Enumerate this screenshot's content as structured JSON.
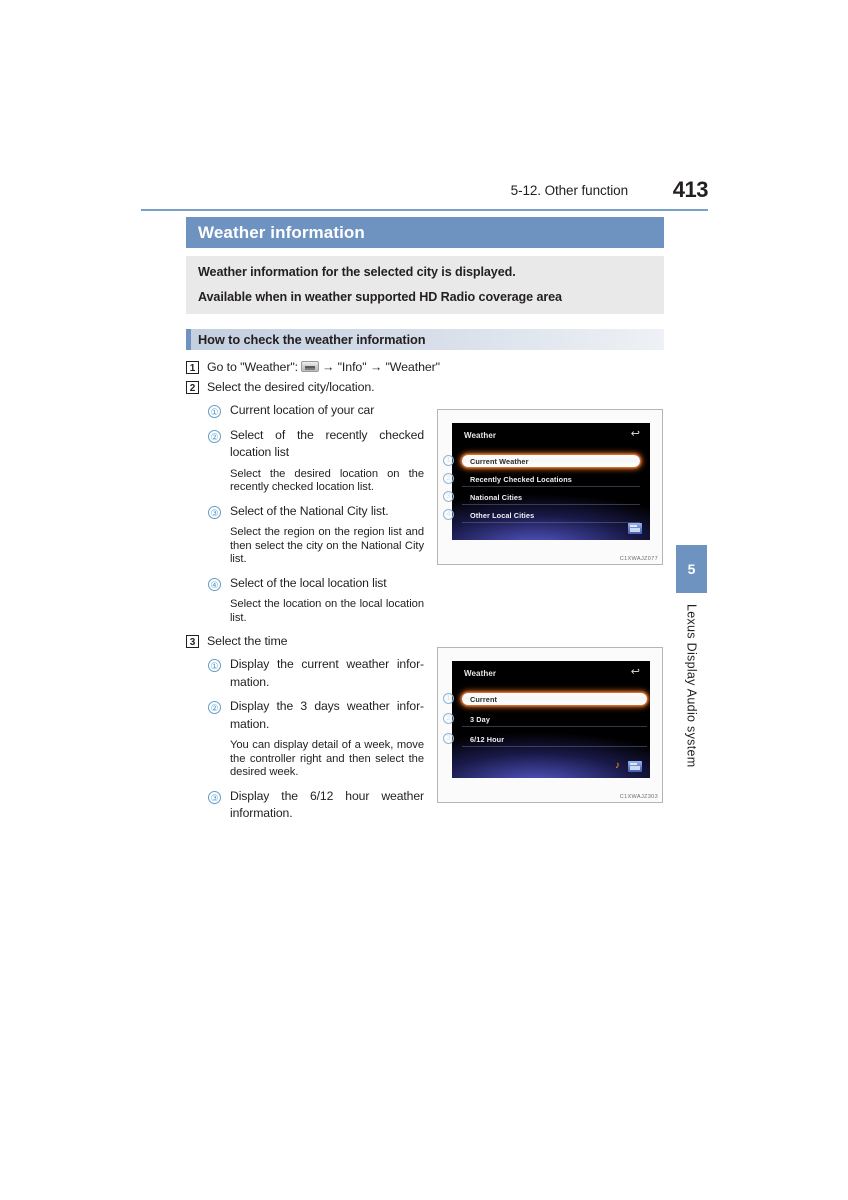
{
  "header": {
    "section": "5-12. Other function",
    "page_number": "413",
    "rule_color": "#7ba0c6"
  },
  "title_bar": {
    "text": "Weather information",
    "bg_color": "#6e93c1"
  },
  "description": {
    "lines": [
      "Weather information for the selected city is displayed.",
      "Available when in weather supported HD Radio coverage area"
    ]
  },
  "sub_header": {
    "text": "How to check the weather information"
  },
  "steps": [
    {
      "num": "1",
      "text_before": "Go to \"Weather\":",
      "icon": "display-menu-icon",
      "text_after": "→ \"Info\" → \"Weather\""
    },
    {
      "num": "2",
      "text": "Select the desired city/location."
    },
    {
      "num": "3",
      "text": "Select the time"
    }
  ],
  "step2_items": [
    {
      "marker": "①",
      "text": "Current location of your car"
    },
    {
      "marker": "②",
      "text": "Select of the recently checked location list",
      "note": "Select the desired location on the recently checked location list."
    },
    {
      "marker": "③",
      "text": "Select of the National City list.",
      "note": "Select the region on the region list and then select the city on the National City list."
    },
    {
      "marker": "④",
      "text": "Select of the local location list",
      "note": "Select the location on the local location list."
    }
  ],
  "step3_items": [
    {
      "marker": "①",
      "text": "Display the current weather infor-mation."
    },
    {
      "marker": "②",
      "text": "Display the 3 days weather infor-mation.",
      "note": "You can display detail of a week, move the controller right and then select the desired week."
    },
    {
      "marker": "③",
      "text": "Display the 6/12 hour weather information."
    }
  ],
  "screenshot1": {
    "screen_title": "Weather",
    "back_icon": "↩",
    "code": "C1XWAJZ077",
    "rows": [
      {
        "callout": "1",
        "label": "Current Weather",
        "selected": true
      },
      {
        "callout": "2",
        "label": "Recently Checked Locations",
        "selected": false
      },
      {
        "callout": "3",
        "label": "National Cities",
        "selected": false
      },
      {
        "callout": "4",
        "label": "Other Local Cities",
        "selected": false
      }
    ]
  },
  "screenshot2": {
    "screen_title": "Weather",
    "back_icon": "↩",
    "code": "C1XWAJZ303",
    "rows": [
      {
        "callout": "1",
        "label": "Current",
        "selected": true
      },
      {
        "callout": "2",
        "label": "3 Day",
        "selected": false
      },
      {
        "callout": "3",
        "label": "6/12 Hour",
        "selected": false
      }
    ]
  },
  "side_tab": {
    "number": "5",
    "label": "Lexus Display Audio system"
  }
}
